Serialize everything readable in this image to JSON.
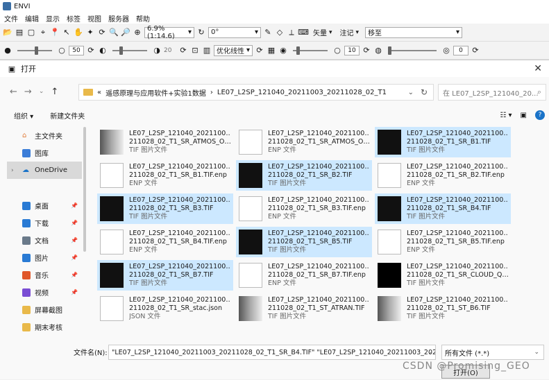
{
  "window": {
    "title": "ENVI"
  },
  "menu": [
    "文件",
    "编辑",
    "显示",
    "标签",
    "视图",
    "服务器",
    "帮助"
  ],
  "toolbar1": {
    "zoom": "6.9% (1:14.6)",
    "rotation": "0°",
    "vector_label": "矢量",
    "annot_label": "注记",
    "goto_value": "移至"
  },
  "toolbar2": {
    "brightness": "50",
    "contrast": "20",
    "stretch": "优化线性",
    "sharpen": "10",
    "transparency": "0"
  },
  "dialog": {
    "title": "打开",
    "address": [
      "遥感原理与应用软件+实验1数据",
      "LE07_L2SP_121040_20211003_20211028_02_T1"
    ],
    "address_prefix": "«",
    "search_placeholder": "在 LE07_L2SP_121040_20...",
    "organize": "组织 ▾",
    "new_folder": "新建文件夹",
    "sidebar": {
      "quick_access": "主文件夹",
      "gallery": "图库",
      "onedrive": "OneDrive",
      "items": [
        "桌面",
        "下载",
        "文档",
        "图片",
        "音乐",
        "视频",
        "屏幕截图",
        "期末考核"
      ]
    },
    "files": [
      {
        "l1": "LE07_L2SP_121040_20211003_20",
        "l2": "211028_02_T1_SR_ATMOS_OP...",
        "type": "TIF 图片文件",
        "kind": "img-gray",
        "sel": false
      },
      {
        "l1": "LE07_L2SP_121040_20211003_20",
        "l2": "211028_02_T1_SR_ATMOS_OP...",
        "type": "ENP 文件",
        "kind": "doc",
        "sel": false
      },
      {
        "l1": "LE07_L2SP_121040_20211003_20",
        "l2": "211028_02_T1_SR_B1.TIF",
        "type": "TIF 图片文件",
        "kind": "img",
        "sel": true
      },
      {
        "l1": "LE07_L2SP_121040_20211003_20",
        "l2": "211028_02_T1_SR_B1.TIF.enp",
        "type": "ENP 文件",
        "kind": "doc",
        "sel": false
      },
      {
        "l1": "LE07_L2SP_121040_20211003_20",
        "l2": "211028_02_T1_SR_B2.TIF",
        "type": "TIF 图片文件",
        "kind": "img",
        "sel": true
      },
      {
        "l1": "LE07_L2SP_121040_20211003_20",
        "l2": "211028_02_T1_SR_B2.TIF.enp",
        "type": "ENP 文件",
        "kind": "doc",
        "sel": false
      },
      {
        "l1": "LE07_L2SP_121040_20211003_20",
        "l2": "211028_02_T1_SR_B3.TIF",
        "type": "TIF 图片文件",
        "kind": "img",
        "sel": true
      },
      {
        "l1": "LE07_L2SP_121040_20211003_20",
        "l2": "211028_02_T1_SR_B3.TIF.enp",
        "type": "ENP 文件",
        "kind": "doc",
        "sel": false
      },
      {
        "l1": "LE07_L2SP_121040_20211003_20",
        "l2": "211028_02_T1_SR_B4.TIF",
        "type": "TIF 图片文件",
        "kind": "img",
        "sel": true
      },
      {
        "l1": "LE07_L2SP_121040_20211003_20",
        "l2": "211028_02_T1_SR_B4.TIF.enp",
        "type": "ENP 文件",
        "kind": "doc",
        "sel": false
      },
      {
        "l1": "LE07_L2SP_121040_20211003_20",
        "l2": "211028_02_T1_SR_B5.TIF",
        "type": "TIF 图片文件",
        "kind": "img",
        "sel": true
      },
      {
        "l1": "LE07_L2SP_121040_20211003_20",
        "l2": "211028_02_T1_SR_B5.TIF.enp",
        "type": "ENP 文件",
        "kind": "doc",
        "sel": false
      },
      {
        "l1": "LE07_L2SP_121040_20211003_20",
        "l2": "211028_02_T1_SR_B7.TIF",
        "type": "TIF 图片文件",
        "kind": "img",
        "sel": true
      },
      {
        "l1": "LE07_L2SP_121040_20211003_20",
        "l2": "211028_02_T1_SR_B7.TIF.enp",
        "type": "ENP 文件",
        "kind": "doc",
        "sel": false
      },
      {
        "l1": "LE07_L2SP_121040_20211003_20",
        "l2": "211028_02_T1_SR_CLOUD_QA...",
        "type": "TIF 图片文件",
        "kind": "img-black",
        "sel": false
      },
      {
        "l1": "LE07_L2SP_121040_20211003_20",
        "l2": "211028_02_T1_SR_stac.json",
        "type": "JSON 文件",
        "kind": "doc",
        "sel": false
      },
      {
        "l1": "LE07_L2SP_121040_20211003_20",
        "l2": "211028_02_T1_ST_ATRAN.TIF",
        "type": "TIF 图片文件",
        "kind": "img-gray",
        "sel": false
      },
      {
        "l1": "LE07_L2SP_121040_20211003_20",
        "l2": "211028_02_T1_ST_B6.TIF",
        "type": "TIF 图片文件",
        "kind": "img-gray",
        "sel": false
      }
    ],
    "filename_label": "文件名(N):",
    "filename_value": "\"LE07_L2SP_121040_20211003_20211028_02_T1_SR_B4.TIF\" \"LE07_L2SP_121040_20211003_20211028_",
    "filetype": "所有文件 (*.*)",
    "open_button": "打开(O)"
  },
  "watermark": "CSDN @Promising_GEO"
}
